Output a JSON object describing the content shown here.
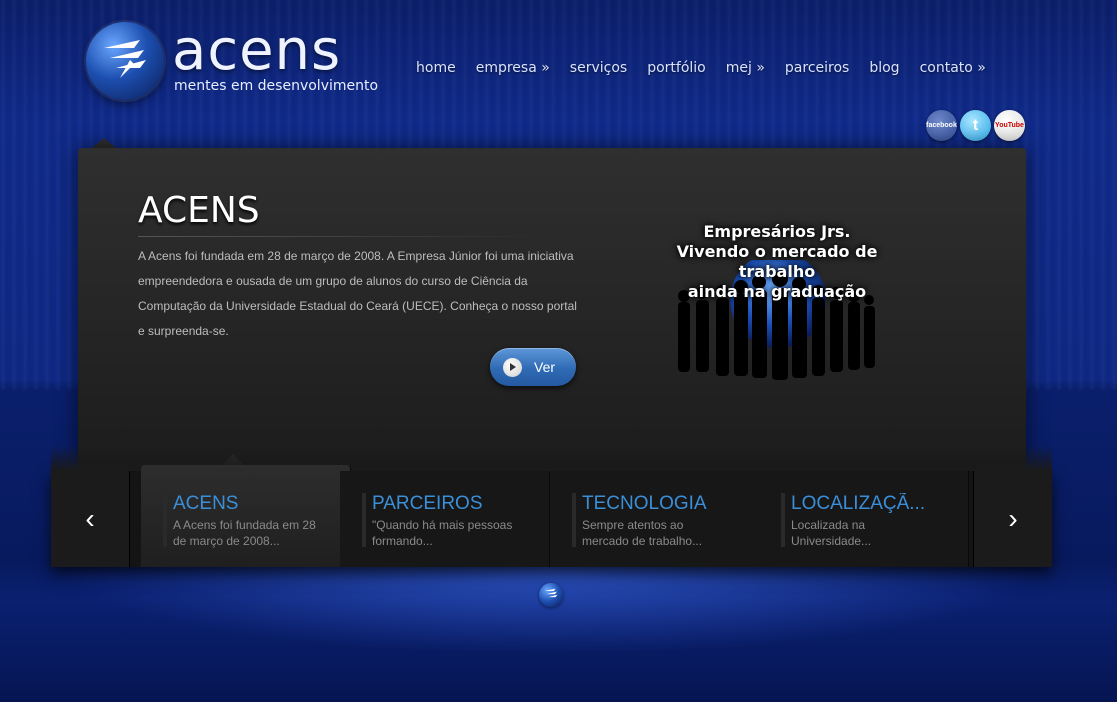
{
  "brand": {
    "name": "acens",
    "tagline": "mentes em desenvolvimento"
  },
  "nav": [
    {
      "label": "home"
    },
    {
      "label": "empresa »"
    },
    {
      "label": "serviços"
    },
    {
      "label": "portfólio"
    },
    {
      "label": "mej »"
    },
    {
      "label": "parceiros"
    },
    {
      "label": "blog"
    },
    {
      "label": "contato »"
    }
  ],
  "social": {
    "facebook": "facebook",
    "twitter": "t",
    "youtube": "YouTube"
  },
  "hero": {
    "title": "ACENS",
    "text": "A Acens foi fundada em 28 de março de 2008. A Empresa Júnior foi uma iniciativa empreendedora e ousada de um grupo de alunos do curso de Ciência da Computação da Universidade Estadual do Ceará (UECE). Conheça o nosso portal e surpreenda-se.",
    "button": "Ver",
    "promo_line1": "Empresários Jrs.",
    "promo_line2": "Vivendo o mercado de trabalho",
    "promo_line3": "ainda na graduação"
  },
  "slider": {
    "prev": "‹",
    "next": "›",
    "tabs": [
      {
        "title": "ACENS",
        "desc": "A Acens foi fundada em 28 de março de 2008..."
      },
      {
        "title": "PARCEIROS",
        "desc": "\"Quando há mais pessoas formando..."
      },
      {
        "title": "TECNOLOGIA",
        "desc": "Sempre atentos ao mercado de trabalho..."
      },
      {
        "title": "LOCALIZAÇÃ...",
        "desc": "Localizada na Universidade..."
      }
    ]
  },
  "icons": {
    "logo": "acens-wing-icon",
    "play": "play-icon",
    "prev": "chevron-left-icon",
    "next": "chevron-right-icon"
  },
  "colors": {
    "accent": "#3b8fd8",
    "background": "#0f2a8a",
    "button": "#2f6bb5"
  }
}
